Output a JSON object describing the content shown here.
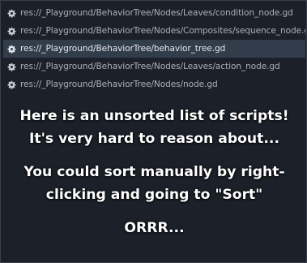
{
  "script_list": {
    "items": [
      {
        "label": "res://_Playground/BehaviorTree/Nodes/Leaves/condition_node.gd",
        "icon": "gear-icon",
        "selected": false
      },
      {
        "label": "res://_Playground/BehaviorTree/Nodes/Composites/sequence_node.gd",
        "icon": "gear-icon",
        "selected": false
      },
      {
        "label": "res://_Playground/BehaviorTree/behavior_tree.gd",
        "icon": "gear-icon",
        "selected": true
      },
      {
        "label": "res://_Playground/BehaviorTree/Nodes/Leaves/action_node.gd",
        "icon": "gear-icon",
        "selected": false
      },
      {
        "label": "res://_Playground/BehaviorTree/Nodes/node.gd",
        "icon": "gear-icon",
        "selected": false
      }
    ]
  },
  "overlay": {
    "line1": "Here is an unsorted list of scripts!",
    "line2": "It's very hard to reason about...",
    "line3": "You could sort manually by right-",
    "line4": "clicking and going to \"Sort\"",
    "line5": "ORRR..."
  },
  "colors": {
    "background": "#1c2129",
    "selected_row": "#323d4c",
    "item_text": "#aab0ba",
    "overlay_text": "#ffffff"
  }
}
